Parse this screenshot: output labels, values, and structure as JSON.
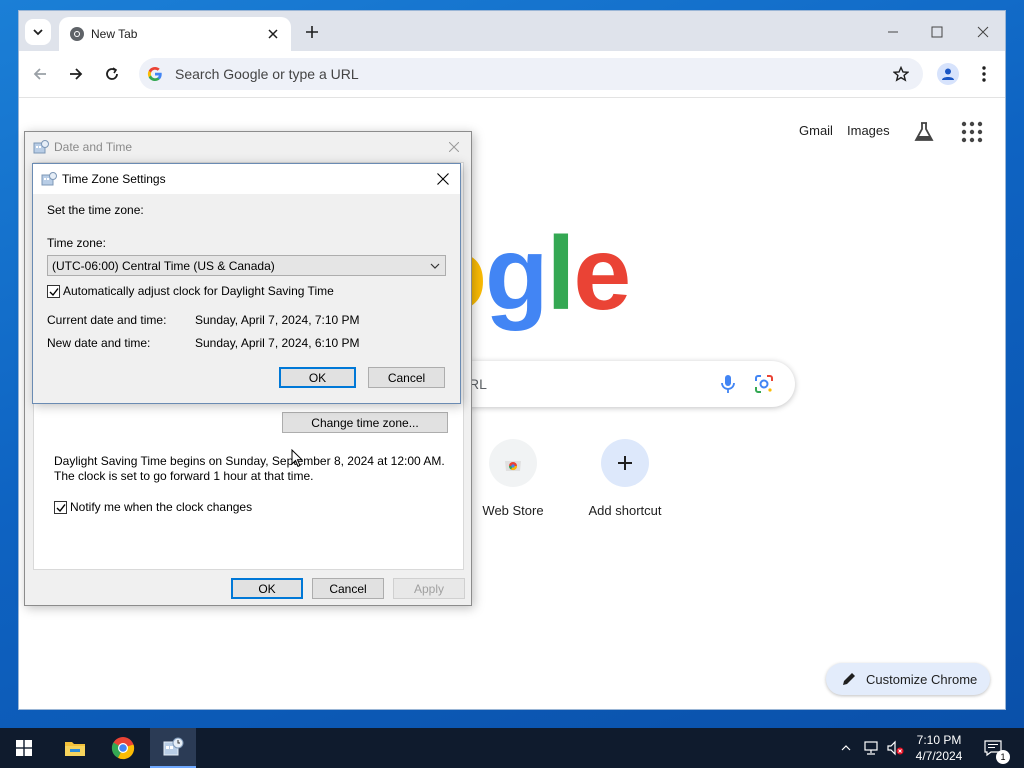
{
  "browser": {
    "tab_title": "New Tab",
    "omnibox_placeholder": "Search Google or type a URL",
    "links": {
      "gmail": "Gmail",
      "images": "Images"
    },
    "search_placeholder_fragment": "RL",
    "shortcuts": [
      {
        "label": "Web Store",
        "icon": "chrome-webstore-icon"
      },
      {
        "label": "Add shortcut",
        "icon": "plus-icon"
      }
    ],
    "customize_label": "Customize Chrome",
    "logo_visible_text": "oogle",
    "colors": {
      "blue": "#4285f4",
      "red": "#ea4335",
      "yellow": "#fbbc05",
      "green": "#34a853"
    }
  },
  "date_time_dialog": {
    "title": "Date and Time",
    "change_tz_button": "Change time zone...",
    "dst_line1": "Daylight Saving Time begins on Sunday, September 8, 2024 at 12:00 AM.",
    "dst_line2": "The clock is set to go forward 1 hour at that time.",
    "notify_label": "Notify me when the clock changes",
    "notify_checked": true,
    "ok": "OK",
    "cancel": "Cancel",
    "apply": "Apply"
  },
  "tz_dialog": {
    "title": "Time Zone Settings",
    "heading": "Set the time zone:",
    "tz_label": "Time zone:",
    "tz_value": "(UTC-06:00) Central Time (US & Canada)",
    "dst_auto_label": "Automatically adjust clock for Daylight Saving Time",
    "dst_auto_checked": true,
    "current_label": "Current date and time:",
    "current_value": "Sunday, April 7, 2024, 7:10 PM",
    "new_label": "New date and time:",
    "new_value": "Sunday, April 7, 2024, 6:10 PM",
    "ok": "OK",
    "cancel": "Cancel"
  },
  "taskbar": {
    "time": "7:10 PM",
    "date": "4/7/2024",
    "notification_count": "1"
  }
}
